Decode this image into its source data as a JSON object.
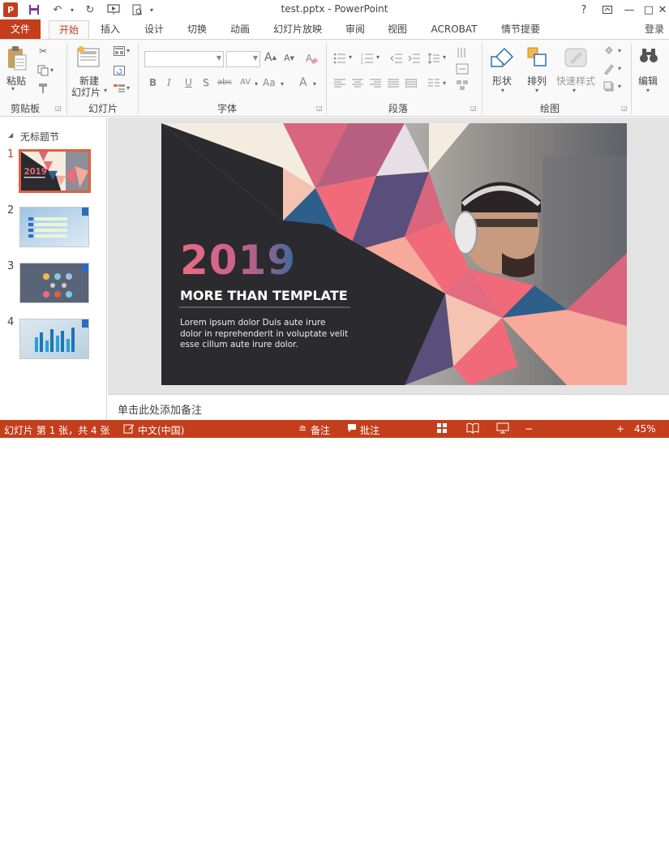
{
  "titlebar": {
    "title": "test.pptx - PowerPoint",
    "app_badge": "P",
    "help": "?",
    "minimize": "—",
    "restore": "□",
    "close": "✕"
  },
  "tabs": {
    "file": "文件",
    "home": "开始",
    "insert": "插入",
    "design": "设计",
    "transitions": "切换",
    "animations": "动画",
    "slideshow": "幻灯片放映",
    "review": "审阅",
    "view": "视图",
    "acrobat": "ACROBAT",
    "storyboard": "情节提要",
    "signin": "登录"
  },
  "ribbon": {
    "clipboard": {
      "paste": "粘贴",
      "label": "剪贴板"
    },
    "slides": {
      "new_slide_line1": "新建",
      "new_slide_line2": "幻灯片",
      "label": "幻灯片"
    },
    "font": {
      "label": "字体",
      "grow": "A",
      "shrink": "A",
      "bold": "B",
      "italic": "I",
      "underline": "U",
      "shadow": "S",
      "strike": "abc",
      "spacing": "AV",
      "case": "Aa",
      "color": "A"
    },
    "paragraph": {
      "label": "段落"
    },
    "drawing": {
      "shapes": "形状",
      "arrange": "排列",
      "quick_styles": "快速样式",
      "label": "绘图"
    },
    "editing": {
      "edit": "编辑"
    }
  },
  "thumbs": {
    "section": "无标题节",
    "items": [
      {
        "num": "1",
        "title": "2019",
        "subtitle": "MORE THAN TEMPLATE"
      },
      {
        "num": "2"
      },
      {
        "num": "3"
      },
      {
        "num": "4"
      }
    ]
  },
  "slide": {
    "year": "2019",
    "headline": "MORE THAN TEMPLATE",
    "body_line1": "Lorem ipsum dolor Duis aute irure",
    "body_line2": "dolor in reprehenderit in voluptate velit",
    "body_line3": "esse cillum aute irure dolor.",
    "accent_pink": "#f06a7a",
    "accent_peach": "#f7a99a",
    "accent_blue": "#2e5f8a",
    "dark": "#2b2a2e"
  },
  "notes": {
    "placeholder": "单击此处添加备注"
  },
  "statusbar": {
    "slide_info": "幻灯片 第 1 张，共 4 张",
    "language": "中文(中国)",
    "notes": "备注",
    "comments": "批注",
    "zoom": "45%",
    "zoom_minus": "−",
    "zoom_plus": "+"
  },
  "colors": {
    "brand": "#c43e1c"
  }
}
